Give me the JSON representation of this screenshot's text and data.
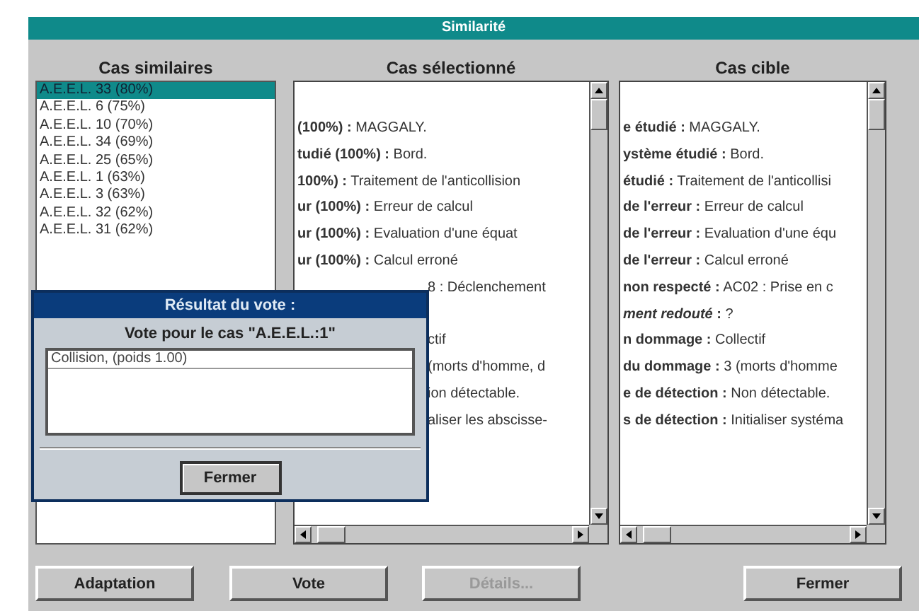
{
  "window": {
    "title": "Similarité"
  },
  "similar_cases": {
    "heading": "Cas similaires",
    "items": [
      {
        "label": "A.E.E.L. 33 (80%)",
        "selected": true
      },
      {
        "label": "A.E.E.L. 6 (75%)",
        "selected": false
      },
      {
        "label": "A.E.E.L. 10 (70%)",
        "selected": false
      },
      {
        "label": "A.E.E.L. 34 (69%)",
        "selected": false
      },
      {
        "label": "A.E.E.L. 25 (65%)",
        "selected": false
      },
      {
        "label": "A.E.E.L. 1 (63%)",
        "selected": false
      },
      {
        "label": "A.E.E.L. 3 (63%)",
        "selected": false
      },
      {
        "label": "A.E.E.L. 32 (62%)",
        "selected": false
      },
      {
        "label": "A.E.E.L. 31 (62%)",
        "selected": false
      }
    ]
  },
  "selected_case": {
    "heading": "Cas sélectionné",
    "lines": [
      {
        "kind": "full",
        "text": "**(100%) :** MAGGALY."
      },
      {
        "kind": "full",
        "text": "**tudié (100%) :** Bord."
      },
      {
        "kind": "full",
        "text": "**100%) :** Traitement de l'anticollision"
      },
      {
        "kind": "full",
        "text": "**ur (100%) :** Erreur de calcul"
      },
      {
        "kind": "full",
        "text": "**ur (100%) :** Evaluation d'une équat"
      },
      {
        "kind": "full",
        "text": "**ur (100%) :** Calcul erroné"
      },
      {
        "kind": "covered",
        "text": "8 : Déclenchement"
      },
      {
        "kind": "gap"
      },
      {
        "kind": "covered",
        "text": "ctif"
      },
      {
        "kind": "covered",
        "text": "(morts d'homme, d"
      },
      {
        "kind": "covered",
        "text": "ion détectable."
      },
      {
        "kind": "covered",
        "text": "aliser les abscisse-"
      }
    ]
  },
  "target_case": {
    "heading": "Cas cible",
    "lines": [
      {
        "kind": "full",
        "text": "**e étudié :** MAGGALY."
      },
      {
        "kind": "full",
        "text": "**ystème étudié :** Bord."
      },
      {
        "kind": "full",
        "text": "**étudié :** Traitement de l'anticollisi"
      },
      {
        "kind": "full",
        "text": "**de l'erreur :** Erreur de calcul"
      },
      {
        "kind": "full",
        "text": "**de l'erreur :** Evaluation d'une équ"
      },
      {
        "kind": "full",
        "text": "**de l'erreur :** Calcul erroné"
      },
      {
        "kind": "full",
        "text": "**non respecté :** AC02 : Prise en c"
      },
      {
        "kind": "full",
        "text": "***ment redouté* :** ?"
      },
      {
        "kind": "full",
        "text": "**n dommage :** Collectif"
      },
      {
        "kind": "full",
        "text": "**du dommage :** 3 (morts d'homme"
      },
      {
        "kind": "full",
        "text": "**e de détection :** Non détectable."
      },
      {
        "kind": "full",
        "text": "**s de détection :** Initialiser systéma"
      }
    ]
  },
  "vote_dialog": {
    "title": "Résultat du vote :",
    "heading": "Vote pour le cas \"A.E.E.L.:1\"",
    "items": [
      {
        "label": "Collision, (poids 1.00)",
        "selected": true
      }
    ],
    "button": "Fermer"
  },
  "buttons": [
    {
      "label": "Adaptation",
      "disabled": false
    },
    {
      "label": "Vote",
      "disabled": false
    },
    {
      "label": "Détails...",
      "disabled": true
    },
    {
      "label": "Fermer",
      "disabled": false
    }
  ]
}
